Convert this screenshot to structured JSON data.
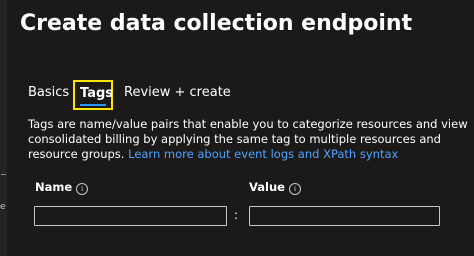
{
  "page": {
    "title": "Create data collection endpoint"
  },
  "tabs": [
    {
      "label": "Basics",
      "selected": false
    },
    {
      "label": "Tags",
      "selected": true
    },
    {
      "label": "Review + create",
      "selected": false
    }
  ],
  "description": {
    "text": "Tags are name/value pairs that enable you to categorize resources and view consolidated billing by applying the same tag to multiple resources and resource groups. ",
    "link": "Learn more about event logs and XPath syntax"
  },
  "table": {
    "name_header": "Name",
    "value_header": "Value",
    "separator": ":",
    "info_glyph": "i",
    "rows": [
      {
        "name": "",
        "value": ""
      }
    ]
  },
  "icons": {
    "info": "info-circle-icon"
  },
  "colors": {
    "background": "#1b1a19",
    "tab_underline": "#2899f5",
    "highlight_box": "#ffe600",
    "link": "#4da3ff"
  }
}
